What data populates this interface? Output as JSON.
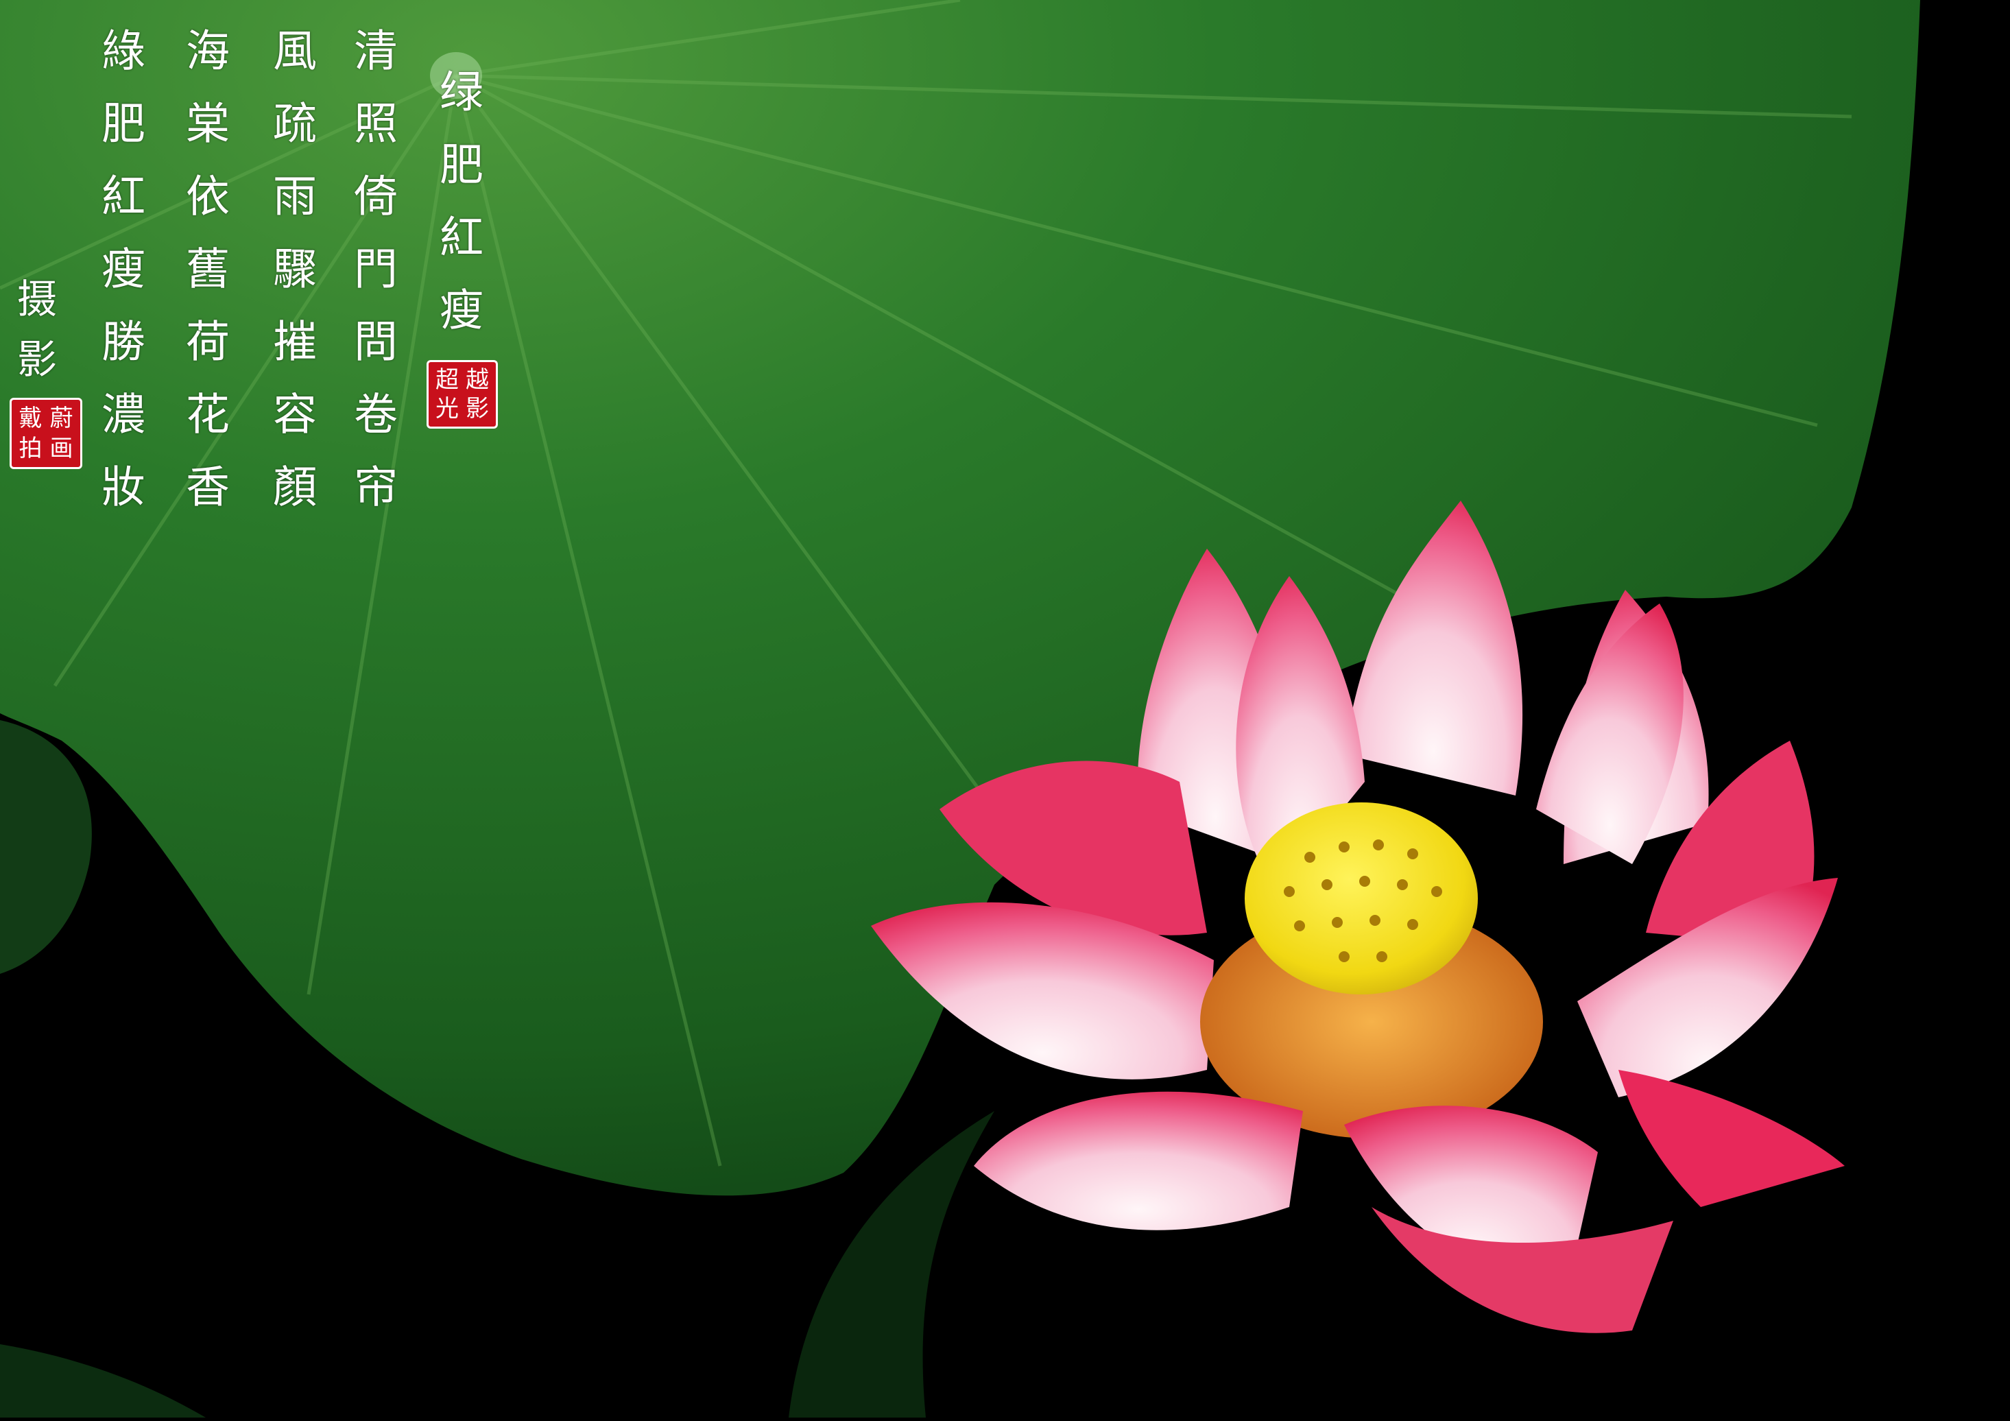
{
  "colors": {
    "background": "#000000",
    "leaf_dark": "#0d3a12",
    "leaf_mid": "#1f6b22",
    "leaf_light": "#4f9a3c",
    "petal_deep": "#e8285a",
    "petal_light": "#fbe3ec",
    "seedpod": "#f3e01a",
    "stamen": "#d8761e",
    "text": "#ffffff",
    "seal": "#c8101c"
  },
  "poem": {
    "title": "绿肥紅瘦",
    "columns": [
      "清照倚門問卷帘",
      "風疏雨驟摧容顏",
      "海棠依舊荷花香",
      "綠肥紅瘦勝濃妝"
    ]
  },
  "credit": "摄影",
  "seals": {
    "title_seal": [
      "超",
      "越",
      "光",
      "影"
    ],
    "credit_seal": [
      "戴",
      "蔚",
      "拍",
      "画"
    ]
  }
}
